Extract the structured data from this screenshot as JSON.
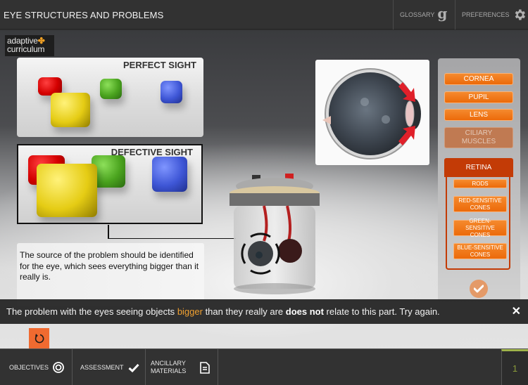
{
  "header": {
    "title": "EYE STRUCTURES AND PROBLEMS",
    "glossary_label": "GLOSSARY",
    "glossary_icon": "g-letter-icon",
    "preferences_label": "PREFERENCES",
    "preferences_icon": "gear-icon"
  },
  "logo": {
    "line1": "adaptive",
    "line2": "curriculum",
    "mark": "✤"
  },
  "panels": {
    "perfect_title": "PERFECT SIGHT",
    "defective_title": "DEFECTIVE SIGHT"
  },
  "description": "The source of the problem should be identified for the eye, which sees everything bigger than it really is.",
  "parts": {
    "buttons": [
      {
        "label": "CORNEA",
        "state": "active"
      },
      {
        "label": "PUPIL",
        "state": "active"
      },
      {
        "label": "LENS",
        "state": "active"
      },
      {
        "label": "CILIARY MUSCLES",
        "state": "disabled"
      }
    ],
    "retina": {
      "label": "RETINA",
      "sub_buttons": [
        {
          "label": "RODS"
        },
        {
          "label": "RED-SENSITIVE CONES"
        },
        {
          "label": "GREEN-SENSITIVE CONES"
        },
        {
          "label": "BLUE-SENSITIVE CONES"
        }
      ]
    },
    "check_icon": "check-icon"
  },
  "feedback": {
    "part1": "The problem with the eyes seeing objects ",
    "highlight": "bigger",
    "part2": " than they really are ",
    "bold": "does not",
    "part3": " relate to this part. Try again.",
    "close_label": "✕"
  },
  "footer": {
    "objectives_label": "OBJECTIVES",
    "assessment_label": "ASSESSMENT",
    "ancillary_label_line1": "ANCILLARY",
    "ancillary_label_line2": "MATERIALS",
    "page_number": "1"
  },
  "colors": {
    "accent_orange": "#ec6a0a",
    "retina_red": "#c33b06",
    "highlight": "#f0a030",
    "page_indicator": "#9fb34a"
  }
}
